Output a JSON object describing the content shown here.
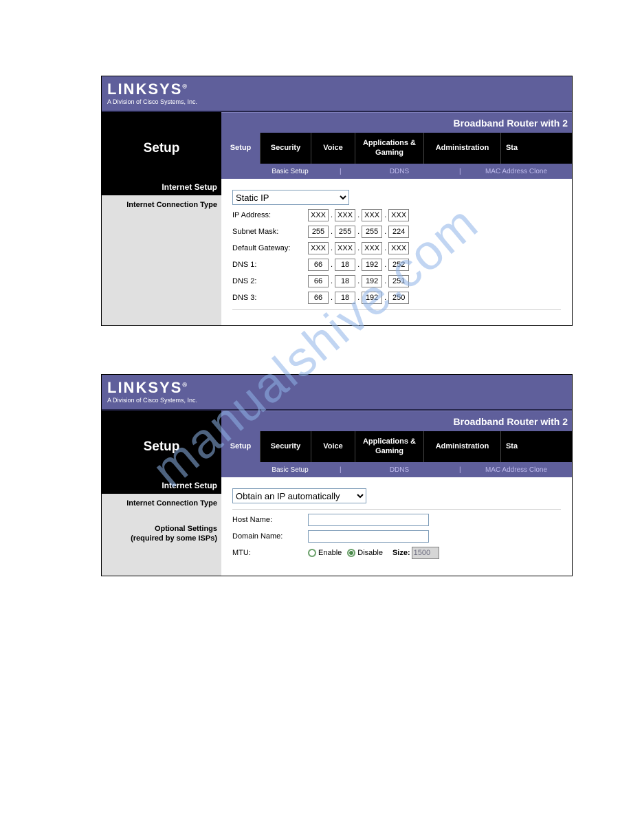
{
  "watermark": "manualshive.com",
  "brand": {
    "logo": "LINKSYS",
    "reg": "®",
    "subtitle": "A Division of Cisco Systems, Inc."
  },
  "model_title": "Broadband Router with 2",
  "page_name": "Setup",
  "tabs": {
    "setup": "Setup",
    "security": "Security",
    "voice": "Voice",
    "apps": "Applications & Gaming",
    "admin": "Administration",
    "sta": "Sta"
  },
  "subnav": {
    "basic": "Basic Setup",
    "ddns": "DDNS",
    "mac": "MAC Address Clone",
    "sep": "|"
  },
  "panel1": {
    "section_header": "Internet Setup",
    "conn_type_label": "Internet Connection Type",
    "conn_type_value": "Static IP",
    "rows": {
      "ip_label": "IP Address:",
      "subnet_label": "Subnet Mask:",
      "gateway_label": "Default Gateway:",
      "dns1_label": "DNS 1:",
      "dns2_label": "DNS 2:",
      "dns3_label": "DNS 3:"
    },
    "ip": [
      "XXX",
      "XXX",
      "XXX",
      "XXX"
    ],
    "subnet": [
      "255",
      "255",
      "255",
      "224"
    ],
    "gateway": [
      "XXX",
      "XXX",
      "XXX",
      "XXX"
    ],
    "dns1": [
      "66",
      "18",
      "192",
      "252"
    ],
    "dns2": [
      "66",
      "18",
      "192",
      "251"
    ],
    "dns3": [
      "66",
      "18",
      "192",
      "250"
    ]
  },
  "panel2": {
    "section_header": "Internet Setup",
    "conn_type_label": "Internet Connection Type",
    "conn_type_value": "Obtain an IP automatically",
    "optional_l1": "Optional Settings",
    "optional_l2": "(required by some ISPs)",
    "host_label": "Host Name:",
    "domain_label": "Domain Name:",
    "mtu_label": "MTU:",
    "mtu_enable": "Enable",
    "mtu_disable": "Disable",
    "mtu_size_label": "Size:",
    "mtu_size_value": "1500",
    "host_value": "",
    "domain_value": ""
  }
}
